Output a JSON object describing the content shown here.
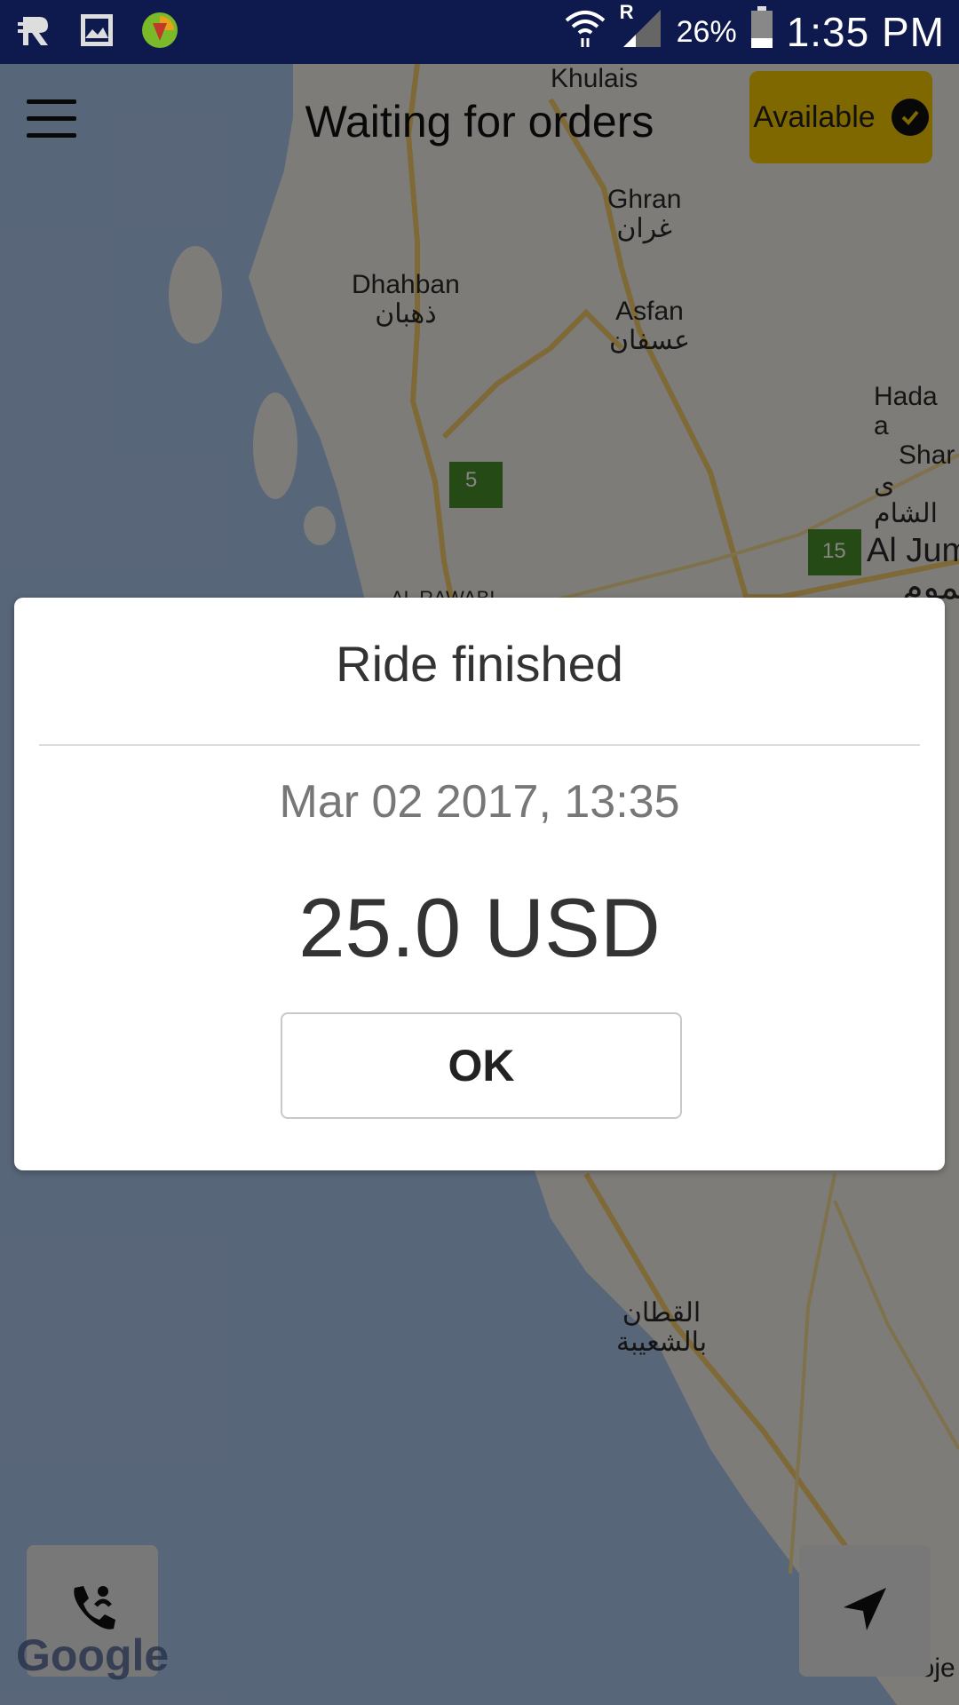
{
  "status_bar": {
    "battery_text": "26%",
    "time": "1:35 PM",
    "icons": [
      "app-r-icon",
      "gallery-icon",
      "location-pin-icon",
      "wifi-icon",
      "signal-icon",
      "battery-icon"
    ],
    "roaming_label": "R"
  },
  "app_bar": {
    "title": "Waiting for orders",
    "status_button_label": "Available",
    "accent_color": "#f5c800"
  },
  "map": {
    "labels": {
      "khulais": "Khulais",
      "ghran_en": "Ghran",
      "ghran_ar": "غران",
      "dhahban_en": "Dhahban",
      "dhahban_ar": "ذهبان",
      "asfan_en": "Asfan",
      "asfan_ar": "عسفان",
      "hada_en": "Hada a",
      "hada_en2": "Shar",
      "hada_ar": "ى الشام",
      "al_jum_en": "Al Jum",
      "al_jum_ar": "جموم",
      "al_rawabi": "AL RAWABI",
      "alqatan_ar1": "القطان",
      "alqatan_ar2": "بالشعيبة",
      "almoje": "Almoje",
      "route_5": "5",
      "route_15": "15"
    },
    "attribution": "Google"
  },
  "dialog": {
    "title": "Ride finished",
    "datetime": "Mar 02 2017, 13:35",
    "amount": "25.0 USD",
    "ok_label": "OK"
  }
}
